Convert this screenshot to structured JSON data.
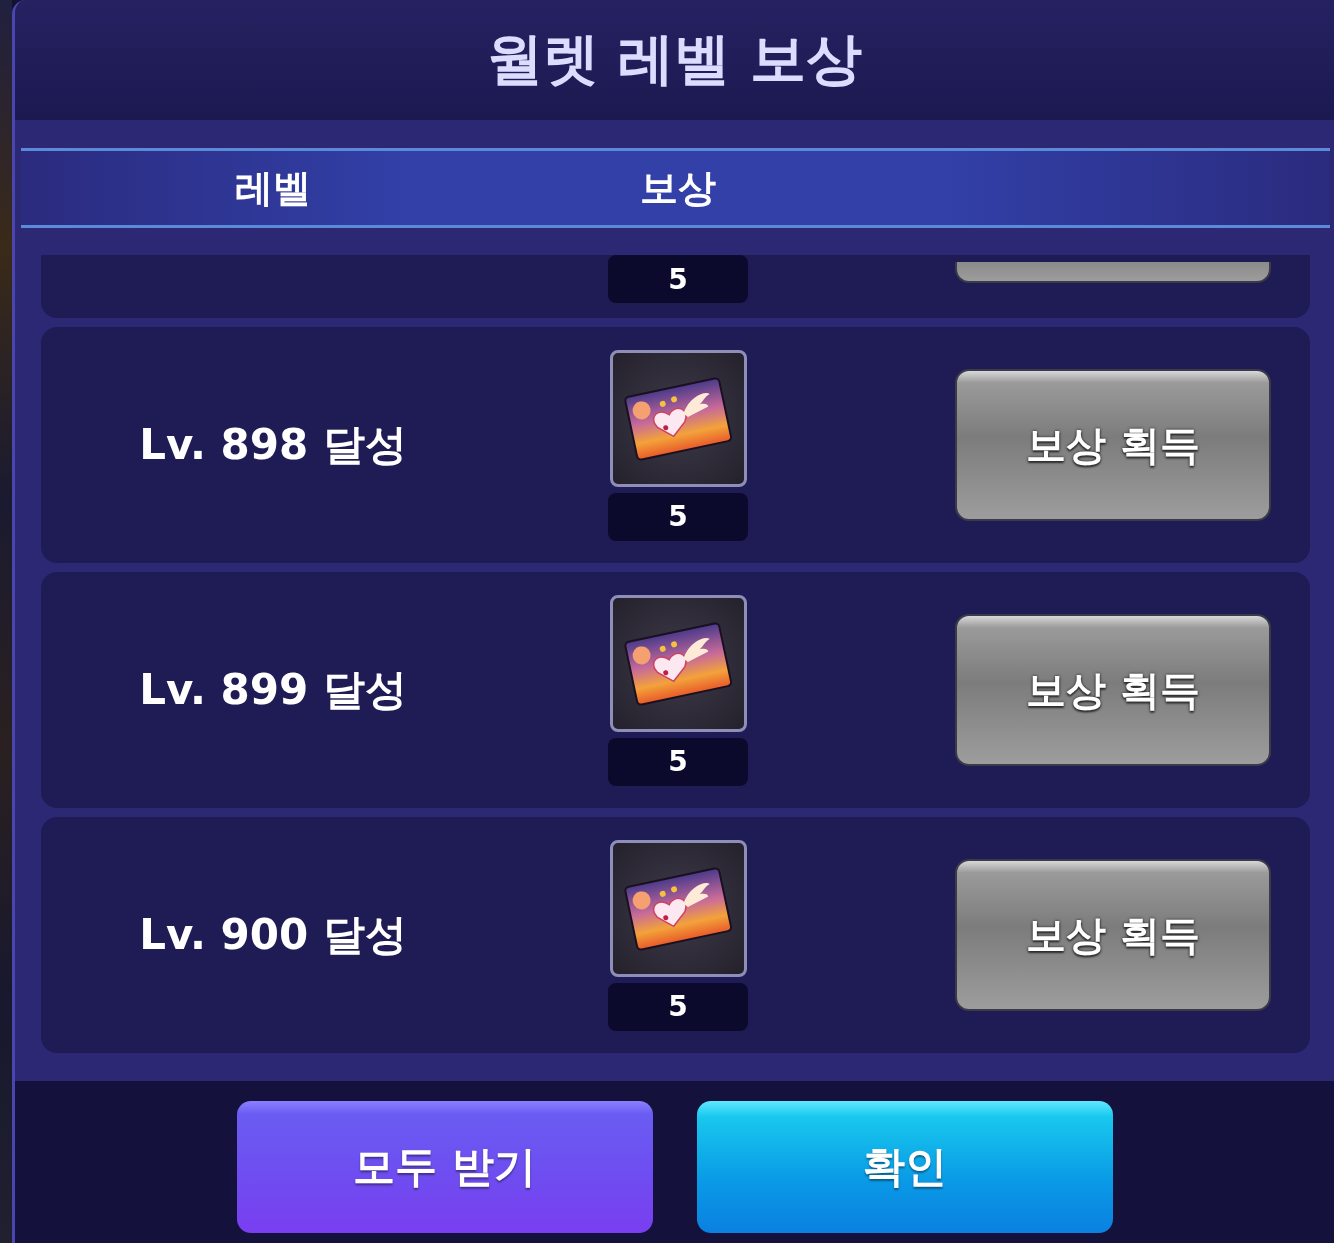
{
  "dialog": {
    "title": "월렛 레벨 보상"
  },
  "columns": [
    "레벨",
    "보상"
  ],
  "rows": [
    {
      "kind": "clipped",
      "count": "5"
    },
    {
      "kind": "full",
      "level": "Lv. 898 달성",
      "count": "5",
      "button": "보상 획득"
    },
    {
      "kind": "full",
      "level": "Lv. 899 달성",
      "count": "5",
      "button": "보상 획득"
    },
    {
      "kind": "full",
      "level": "Lv. 900 달성",
      "count": "5",
      "button": "보상 획득"
    }
  ],
  "footer_buttons": [
    {
      "label": "모두 받기",
      "kind": "secondary"
    },
    {
      "label": "확인",
      "kind": "primary"
    }
  ]
}
